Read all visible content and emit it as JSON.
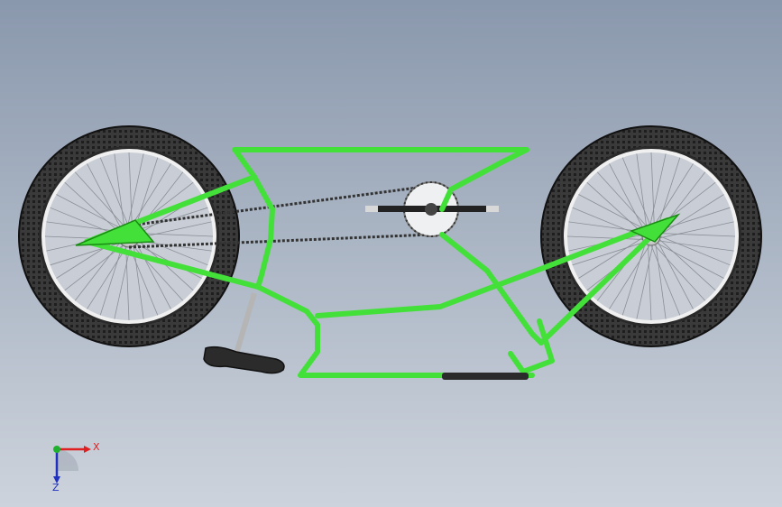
{
  "viewport": {
    "model": "bicycle-frame",
    "colors": {
      "frame": "#44e03a",
      "frame_dark": "#1a8a14",
      "tire": "#2b2b2b",
      "chain": "#333333",
      "axis_x": "#e02020",
      "axis_y": "#20b030",
      "axis_z": "#2030c0"
    }
  },
  "triad": {
    "x_label": "X",
    "z_label": "Z"
  }
}
